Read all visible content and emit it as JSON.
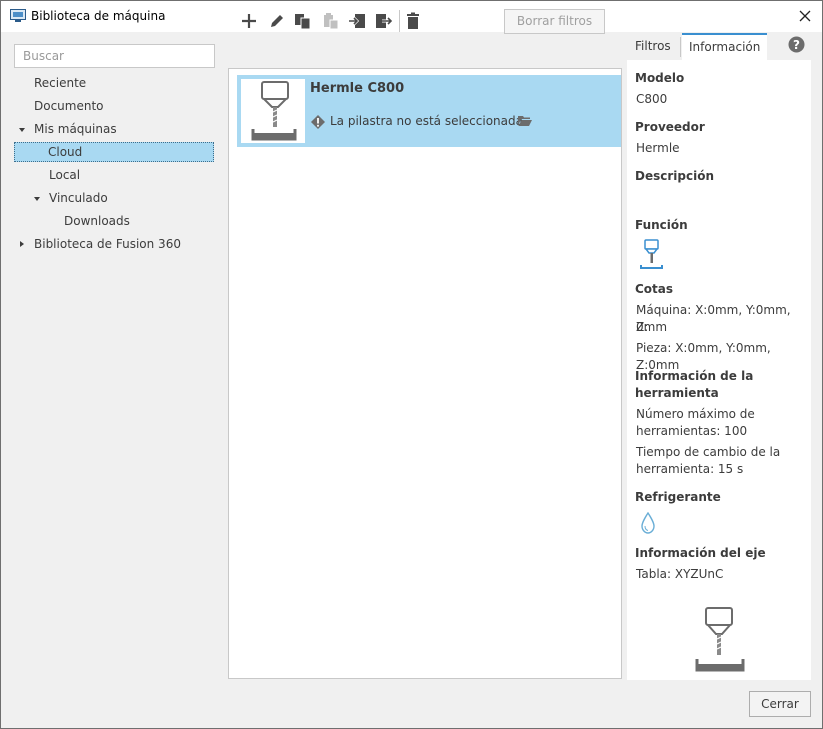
{
  "window": {
    "title": "Biblioteca de máquina"
  },
  "search": {
    "placeholder": "Buscar"
  },
  "tree": {
    "recent": "Reciente",
    "document": "Documento",
    "my_machines": "Mis máquinas",
    "cloud": "Cloud",
    "local": "Local",
    "linked": "Vinculado",
    "downloads": "Downloads",
    "fusion_library": "Biblioteca de Fusion 360"
  },
  "toolbar": {
    "icons": [
      "add-icon",
      "edit-icon",
      "copy-icon",
      "paste-icon",
      "import-icon",
      "export-icon",
      "delete-icon"
    ],
    "clear_filters": "Borrar filtros"
  },
  "machines": [
    {
      "name": "Hermle C800",
      "warning": "La pilastra no está seleccionada"
    }
  ],
  "tabs": {
    "filters": "Filtros",
    "info": "Información"
  },
  "info": {
    "model_label": "Modelo",
    "model_value": "C800",
    "vendor_label": "Proveedor",
    "vendor_value": "Hermle",
    "description_label": "Descripción",
    "function_label": "Función",
    "dimensions_label": "Cotas",
    "machine_dims_1": "Máquina: X:0mm, Y:0mm, Z:",
    "machine_dims_2": "0mm",
    "part_dims": "Pieza: X:0mm, Y:0mm, Z:0mm",
    "tool_info_label_1": "Información de la",
    "tool_info_label_2": "herramienta",
    "max_tools_1": "Número máximo de",
    "max_tools_2": "herramientas: 100",
    "tool_change_1": "Tiempo de cambio de la",
    "tool_change_2": "herramienta: 15 s",
    "coolant_label": "Refrigerante",
    "axis_info_label": "Información del eje",
    "axis_table": "Tabla: XYZUnC"
  },
  "footer": {
    "close": "Cerrar"
  },
  "colors": {
    "selection": "#a9d9f2",
    "accent": "#3a8fd0",
    "coolant": "#6aaed6"
  }
}
